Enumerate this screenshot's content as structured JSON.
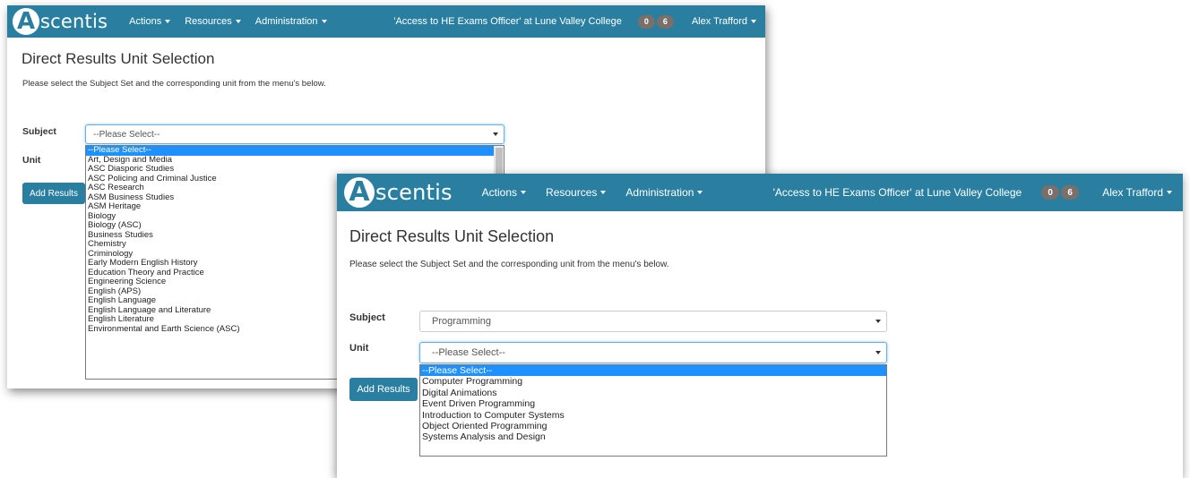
{
  "app": {
    "logo_letter": "A",
    "logo_text": "scentis",
    "nav": [
      "Actions",
      "Resources",
      "Administration"
    ],
    "org": "'Access to HE Exams Officer' at Lune Valley College",
    "badges": [
      "0",
      "6"
    ],
    "user": "Alex Trafford",
    "accent": "#2a7fa1"
  },
  "page": {
    "title": "Direct Results Unit Selection",
    "description": "Please select the Subject Set and the corresponding unit from the menu's below.",
    "subject_label": "Subject",
    "unit_label": "Unit",
    "add_results_label": "Add Results"
  },
  "window1": {
    "subject_value": "--Please Select--",
    "subject_options": [
      "--Please Select--",
      "Art, Design and Media",
      "ASC Diasporic Studies",
      "ASC Policing and Criminal Justice",
      "ASC Research",
      "ASM Business Studies",
      "ASM Heritage",
      "Biology",
      "Biology (ASC)",
      "Business Studies",
      "Chemistry",
      "Criminology",
      "Early Modern English History",
      "Education Theory and Practice",
      "Engineering Science",
      "English (APS)",
      "English Language",
      "English Language and Literature",
      "English Literature",
      "Environmental and Earth Science (ASC)"
    ]
  },
  "window2": {
    "subject_value": "Programming",
    "unit_value": "--Please Select--",
    "unit_options": [
      "--Please Select--",
      "Computer Programming",
      "Digital Animations",
      "Event Driven Programming",
      "Introduction to Computer Systems",
      "Object Oriented Programming",
      "Systems Analysis and Design"
    ]
  }
}
